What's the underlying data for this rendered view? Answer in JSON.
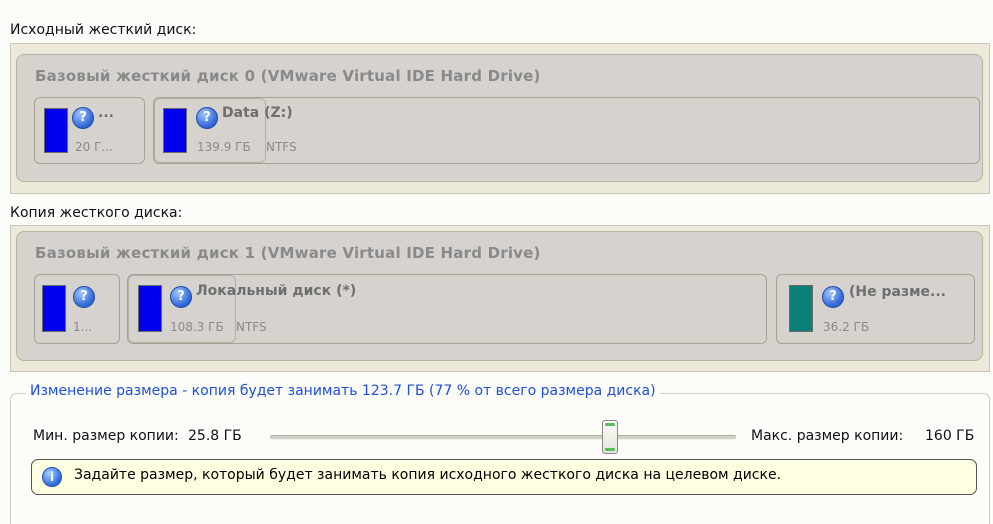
{
  "source": {
    "label": "Исходный жесткий диск:",
    "disk_title": "Базовый жесткий диск 0 (VMware Virtual IDE Hard Drive)",
    "partitions": [
      {
        "name": "...",
        "size": "20 Г...",
        "fs": "",
        "color": "#0000ee"
      },
      {
        "name": "Data (Z:)",
        "size": "139.9 ГБ",
        "fs": "NTFS",
        "color": "#0000ee"
      }
    ]
  },
  "copy": {
    "label": "Копия жесткого диска:",
    "disk_title": "Базовый жесткий диск 1 (VMware Virtual IDE Hard Drive)",
    "partitions": [
      {
        "name": "",
        "size": "1...",
        "fs": "",
        "color": "#0000ee"
      },
      {
        "name": "Локальный диск (*)",
        "size": "108.3 ГБ",
        "fs": "NTFS",
        "color": "#0000ee"
      },
      {
        "name": "(Не разме...",
        "size": "36.2 ГБ",
        "fs": "",
        "color": "#0b7f78"
      }
    ]
  },
  "resize": {
    "legend": "Изменение размера - копия будет занимать 123.7 ГБ (77 % от всего размера диска)",
    "min_label": "Мин. размер копии:",
    "min_value": "25.8 ГБ",
    "max_label": "Макс. размер копии:",
    "max_value": "160 ГБ",
    "slider_percent": 77
  },
  "hint": {
    "text": "Задайте размер, который будет занимать копия исходного жесткого диска на целевом диске."
  },
  "icons": {
    "question": "?",
    "info": "i"
  },
  "colors": {
    "accent_text": "#1f4fd8",
    "primary_partition": "#0000ee",
    "unallocated_partition": "#0b7f78"
  }
}
